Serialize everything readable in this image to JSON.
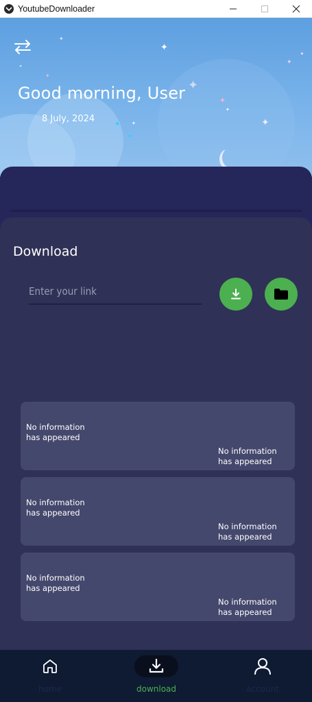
{
  "window": {
    "title": "YoutubeDownloader"
  },
  "header": {
    "greeting": "Good morning, User",
    "date": "8 July, 2024"
  },
  "download_section": {
    "title": "Download",
    "link_placeholder": "Enter your link"
  },
  "info_cards": [
    {
      "left_text": "No information\nhas appeared",
      "right_text": "No information\nhas appeared"
    },
    {
      "left_text": "No information\nhas appeared",
      "right_text": "No information\nhas appeared"
    },
    {
      "left_text": "No information\nhas appeared",
      "right_text": "No information\nhas appeared"
    }
  ],
  "bottom_nav": {
    "items": [
      {
        "label": "home",
        "icon": "home-icon",
        "active": false
      },
      {
        "label": "download",
        "icon": "download-icon",
        "active": true
      },
      {
        "label": "account",
        "icon": "account-icon",
        "active": false
      }
    ]
  },
  "colors": {
    "accent": "#4caf50",
    "panel": "#2f3156",
    "card": "#45486d",
    "nav_bg": "#0f1a33"
  }
}
